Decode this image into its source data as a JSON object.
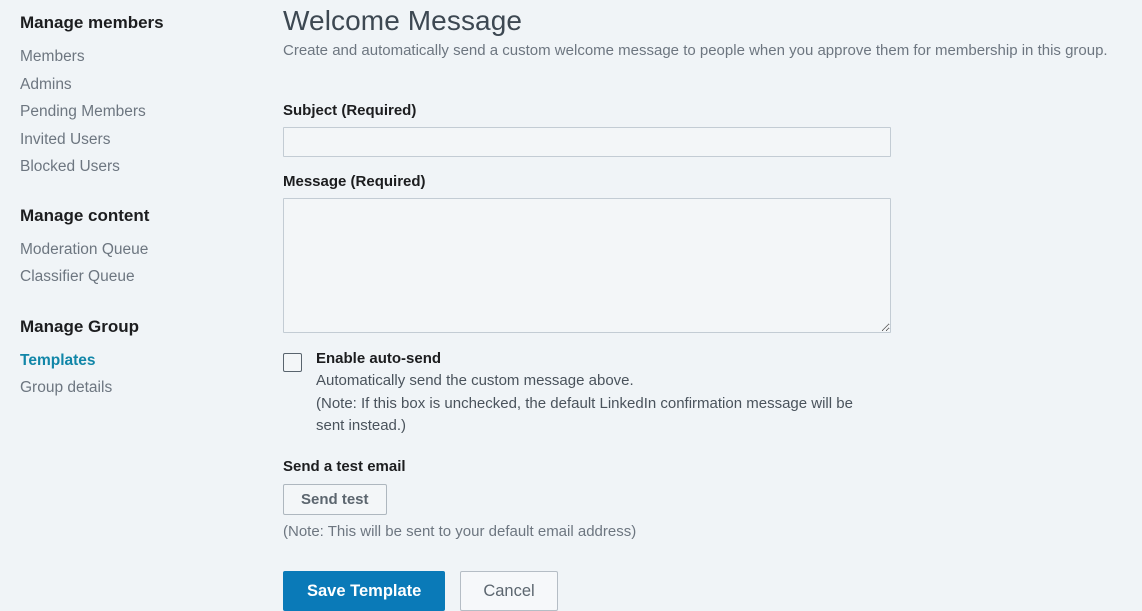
{
  "sidebar": {
    "groups": [
      {
        "heading": "Manage members",
        "items": [
          {
            "label": "Members",
            "active": false
          },
          {
            "label": "Admins",
            "active": false
          },
          {
            "label": "Pending Members",
            "active": false
          },
          {
            "label": "Invited Users",
            "active": false
          },
          {
            "label": "Blocked Users",
            "active": false
          }
        ]
      },
      {
        "heading": "Manage content",
        "items": [
          {
            "label": "Moderation Queue",
            "active": false
          },
          {
            "label": "Classifier Queue",
            "active": false
          }
        ]
      },
      {
        "heading": "Manage Group",
        "items": [
          {
            "label": "Templates",
            "active": true
          },
          {
            "label": "Group details",
            "active": false
          }
        ]
      }
    ]
  },
  "main": {
    "title": "Welcome Message",
    "subtitle": "Create and automatically send a custom welcome message to people when you approve them for membership in this group.",
    "subject": {
      "label": "Subject (Required)",
      "value": "",
      "placeholder": ""
    },
    "message": {
      "label": "Message (Required)",
      "value": "",
      "placeholder": ""
    },
    "auto_send": {
      "title": "Enable auto-send",
      "description_line1": "Automatically send the custom message above.",
      "description_line2": "(Note: If this box is unchecked, the default LinkedIn confirmation message will be",
      "description_line3": "sent instead.)",
      "checked": false
    },
    "send_test": {
      "label": "Send a test email",
      "button_label": "Send test",
      "note": "(Note: This will be sent to your default email address)"
    },
    "actions": {
      "save_label": "Save Template",
      "cancel_label": "Cancel"
    }
  },
  "colors": {
    "page_background": "#f0f4f7",
    "accent_primary": "#0a7ab8",
    "active_link": "#1186a8",
    "muted_text": "#6d7680",
    "heading_text": "#1c1d1f",
    "input_border": "#c3ccd4"
  }
}
